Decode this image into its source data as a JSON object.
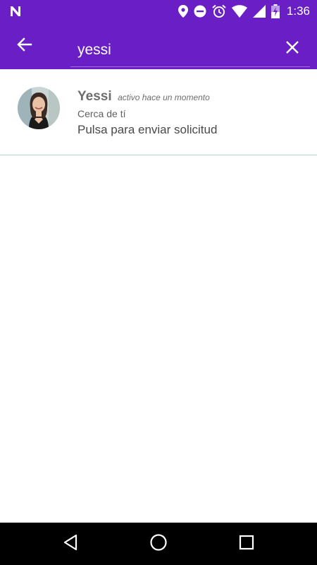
{
  "status_bar": {
    "time": "1:36",
    "icons": [
      "n-logo-icon",
      "location-icon",
      "dnd-icon",
      "alarm-icon",
      "wifi-icon",
      "signal-icon",
      "battery-charging-icon"
    ]
  },
  "toolbar": {
    "search_value": "yessi",
    "back_icon": "arrow-back-icon",
    "clear_icon": "close-icon"
  },
  "results": [
    {
      "name": "Yessi",
      "activity": "activo hace un momento",
      "distance": "Cerca de tí",
      "action": "Pulsa para enviar solicitud"
    }
  ],
  "nav_bar": {
    "buttons": [
      "back-triangle-icon",
      "home-circle-icon",
      "recents-square-icon"
    ]
  },
  "colors": {
    "primary": "#6a1fc6",
    "divider": "#b7d3cd",
    "text_secondary": "#6d6d6d"
  }
}
